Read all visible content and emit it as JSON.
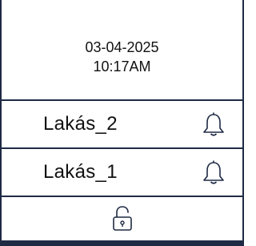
{
  "header": {
    "date": "03-04-2025",
    "time": "10:17AM"
  },
  "apartments": [
    {
      "label": "Lakás_2",
      "icon": "bell-icon"
    },
    {
      "label": "Lakás_1",
      "icon": "bell-icon"
    }
  ],
  "footer": {
    "icon": "unlock-icon"
  },
  "colors": {
    "border": "#1f2a44",
    "text": "#111111",
    "background": "#ffffff"
  }
}
